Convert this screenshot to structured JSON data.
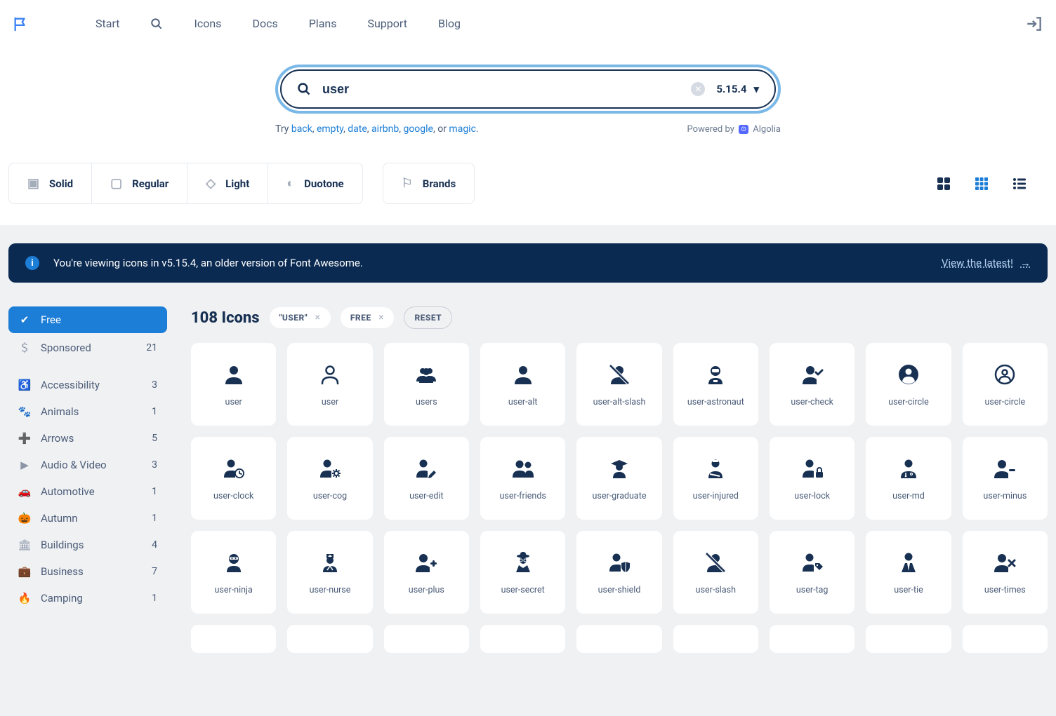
{
  "nav": {
    "items": [
      "Start",
      "Icons",
      "Docs",
      "Plans",
      "Support",
      "Blog"
    ]
  },
  "search": {
    "value": "user",
    "version": "5.15.4",
    "try_label": "Try",
    "suggestions": [
      "back",
      "empty",
      "date",
      "airbnb",
      "google"
    ],
    "or_word": ", or ",
    "last_suggestion": "magic",
    "powered_label": "Powered by",
    "powered_name": "Algolia"
  },
  "styles": [
    "Solid",
    "Regular",
    "Light",
    "Duotone"
  ],
  "brands_label": "Brands",
  "banner": {
    "text": "You're viewing icons in v5.15.4, an older version of Font Awesome.",
    "link": "View the latest!"
  },
  "sidebar": {
    "free": "Free",
    "sponsored": {
      "label": "Sponsored",
      "count": "21"
    },
    "cats": [
      {
        "label": "Accessibility",
        "count": "3",
        "icon": "♿"
      },
      {
        "label": "Animals",
        "count": "1",
        "icon": "🐾"
      },
      {
        "label": "Arrows",
        "count": "5",
        "icon": "➕"
      },
      {
        "label": "Audio & Video",
        "count": "3",
        "icon": "▶"
      },
      {
        "label": "Automotive",
        "count": "1",
        "icon": "🚗"
      },
      {
        "label": "Autumn",
        "count": "1",
        "icon": "🎃"
      },
      {
        "label": "Buildings",
        "count": "4",
        "icon": "🏛"
      },
      {
        "label": "Business",
        "count": "7",
        "icon": "💼"
      },
      {
        "label": "Camping",
        "count": "1",
        "icon": "🔥"
      }
    ]
  },
  "results": {
    "count_label": "108 Icons",
    "tag_user": "\"USER\"",
    "tag_free": "FREE",
    "reset": "RESET"
  },
  "icons": [
    {
      "name": "user",
      "glyph": "user"
    },
    {
      "name": "user",
      "glyph": "user-o"
    },
    {
      "name": "users",
      "glyph": "users"
    },
    {
      "name": "user-alt",
      "glyph": "user"
    },
    {
      "name": "user-alt-slash",
      "glyph": "user-slash"
    },
    {
      "name": "user-astronaut",
      "glyph": "astro"
    },
    {
      "name": "user-check",
      "glyph": "user-check"
    },
    {
      "name": "user-circle",
      "glyph": "circle-solid"
    },
    {
      "name": "user-circle",
      "glyph": "circle-o"
    },
    {
      "name": "user-clock",
      "glyph": "user-clock"
    },
    {
      "name": "user-cog",
      "glyph": "user-cog"
    },
    {
      "name": "user-edit",
      "glyph": "user-edit"
    },
    {
      "name": "user-friends",
      "glyph": "friends"
    },
    {
      "name": "user-graduate",
      "glyph": "grad"
    },
    {
      "name": "user-injured",
      "glyph": "injured"
    },
    {
      "name": "user-lock",
      "glyph": "user-lock"
    },
    {
      "name": "user-md",
      "glyph": "md"
    },
    {
      "name": "user-minus",
      "glyph": "user-minus"
    },
    {
      "name": "user-ninja",
      "glyph": "ninja"
    },
    {
      "name": "user-nurse",
      "glyph": "nurse"
    },
    {
      "name": "user-plus",
      "glyph": "user-plus"
    },
    {
      "name": "user-secret",
      "glyph": "secret"
    },
    {
      "name": "user-shield",
      "glyph": "user-shield"
    },
    {
      "name": "user-slash",
      "glyph": "user-slash"
    },
    {
      "name": "user-tag",
      "glyph": "user-tag"
    },
    {
      "name": "user-tie",
      "glyph": "tie"
    },
    {
      "name": "user-times",
      "glyph": "user-times"
    }
  ]
}
